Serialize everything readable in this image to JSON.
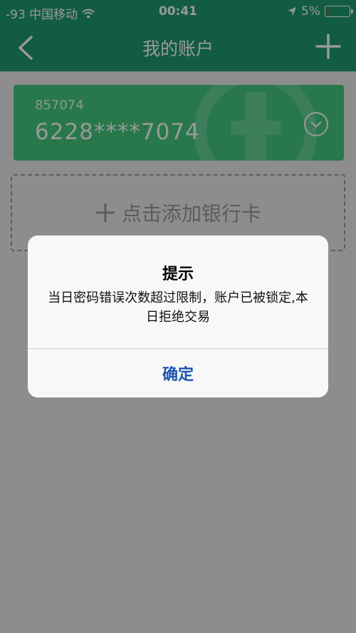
{
  "status": {
    "carrier": "-93 中国移动",
    "time": "00:41",
    "battery_percent": "5%",
    "battery_level": 0.05
  },
  "nav": {
    "title": "我的账户",
    "back_icon": "chevron-left-icon",
    "add_icon": "plus-icon"
  },
  "card": {
    "short_number": "857074",
    "masked_number": "6228****7074",
    "color": "#43c87f"
  },
  "add_card": {
    "label": "点击添加银行卡"
  },
  "dialog": {
    "title": "提示",
    "message": "当日密码错误次数超过限制，账户已被锁定,本日拒绝交易",
    "confirm_label": "确定",
    "confirm_color": "#1a56b0"
  },
  "colors": {
    "header": "#1f9a6e",
    "battery_low": "#e53935"
  }
}
